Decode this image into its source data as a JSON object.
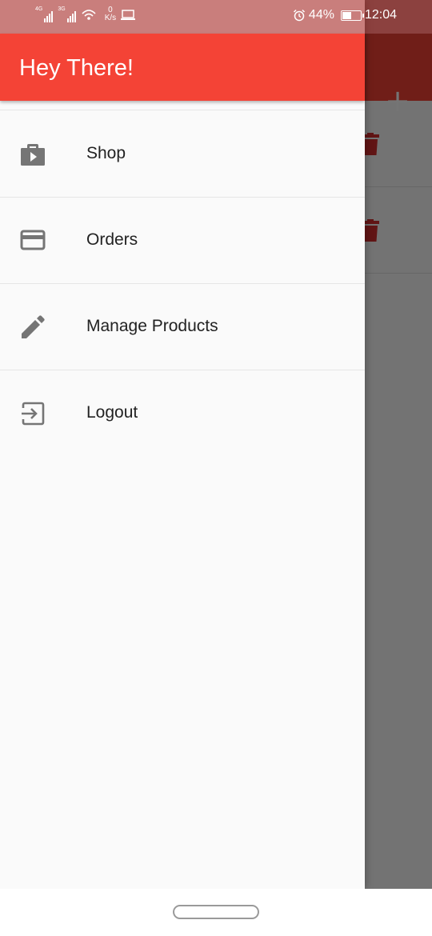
{
  "status_bar": {
    "network_1": "4G",
    "network_2": "3G",
    "speed_value": "0",
    "speed_unit": "K/s",
    "battery_percent": "44%",
    "battery_level": 0.44,
    "time": "12:04",
    "icons": [
      "signal-icon",
      "signal-icon",
      "wifi-icon",
      "laptop-icon",
      "alarm-icon",
      "battery-charging-icon"
    ]
  },
  "background": {
    "add_label": "+",
    "icons": [
      "plus-icon",
      "trash-icon",
      "trash-icon"
    ]
  },
  "drawer": {
    "title": "Hey There!",
    "items": [
      {
        "label": "Shop",
        "icon": "shop-icon"
      },
      {
        "label": "Orders",
        "icon": "payment-card-icon"
      },
      {
        "label": "Manage Products",
        "icon": "edit-icon"
      },
      {
        "label": "Logout",
        "icon": "exit-to-app-icon"
      }
    ]
  },
  "colors": {
    "primary": "#f44336",
    "accent_red": "#d32f2f",
    "icon_grey": "#757575",
    "text": "#222222"
  }
}
